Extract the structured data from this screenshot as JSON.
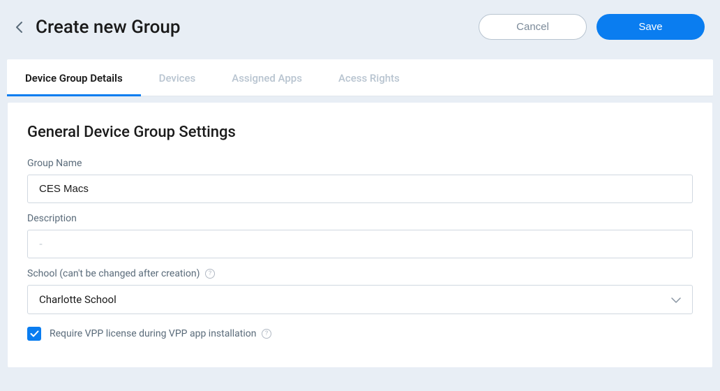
{
  "header": {
    "title": "Create new Group",
    "cancel_label": "Cancel",
    "save_label": "Save"
  },
  "tabs": [
    {
      "label": "Device Group Details",
      "active": true
    },
    {
      "label": "Devices",
      "active": false
    },
    {
      "label": "Assigned Apps",
      "active": false
    },
    {
      "label": "Acess Rights",
      "active": false
    }
  ],
  "form": {
    "section_title": "General Device Group Settings",
    "group_name": {
      "label": "Group Name",
      "value": "CES Macs"
    },
    "description": {
      "label": "Description",
      "value": "",
      "placeholder": "-"
    },
    "school": {
      "label": "School (can't be changed after creation)",
      "value": "Charlotte School"
    },
    "vpp_checkbox": {
      "label": "Require VPP license during VPP app installation",
      "checked": true
    }
  }
}
